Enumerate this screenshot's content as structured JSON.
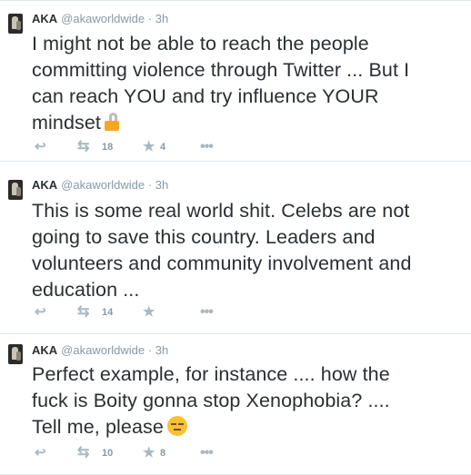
{
  "tweets": [
    {
      "name": "AKA",
      "handle": "@akaworldwide",
      "dot": "·",
      "time": "3h",
      "lines": [
        "I might not be able to reach the people",
        "committing violence through Twitter ... But I",
        "can reach YOU and try influence YOUR",
        "mindset"
      ],
      "emoji": "lock-icon",
      "retweets": "18",
      "favorites": "4"
    },
    {
      "name": "AKA",
      "handle": "@akaworldwide",
      "dot": "·",
      "time": "3h",
      "lines": [
        "This is some real world shit. Celebs are not",
        "going to save this country. Leaders and",
        "volunteers and community involvement and",
        "education ..."
      ],
      "retweets": "14",
      "favorites": ""
    },
    {
      "name": "AKA",
      "handle": "@akaworldwide",
      "dot": "·",
      "time": "3h",
      "lines": [
        "Perfect example, for instance .... how the",
        "fuck is Boity gonna stop Xenophobia? ....",
        "Tell me, please"
      ],
      "emoji": "unamused-face-icon",
      "retweets": "10",
      "favorites": "8"
    }
  ],
  "icons": {
    "reply": "reply-icon",
    "retweet": "retweet-icon",
    "favorite": "star-icon",
    "more": "more-icon"
  },
  "colors": {
    "text": "#292f33",
    "meta": "#8899a6",
    "action_icon": "#aab8c2",
    "divider": "#e1e8ed"
  }
}
